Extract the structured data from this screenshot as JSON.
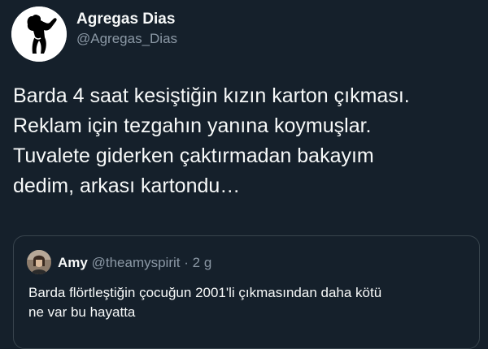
{
  "author": {
    "display_name": "Agregas Dias",
    "handle": "@Agregas_Dias",
    "avatar_icon": "silhouette-figure-avatar"
  },
  "tweet": {
    "lines": [
      "Barda 4 saat kesiştiğin kızın karton çıkması.",
      "Reklam için tezgahın yanına koymuşlar.",
      "Tuvalete giderken çaktırmadan bakayım",
      "dedim, arkası kartondu…"
    ]
  },
  "quoted_tweet": {
    "display_name": "Amy",
    "handle": "@theamyspirit",
    "separator": "·",
    "time": "2 g",
    "lines": [
      "Barda flörtleştiğin çocuğun 2001'li çıkmasından daha kötü",
      "ne var bu hayatta"
    ]
  },
  "colors": {
    "background": "#15202b",
    "text_primary": "#f7f9f9",
    "text_secondary": "#8b98a5",
    "border": "#38444d"
  }
}
